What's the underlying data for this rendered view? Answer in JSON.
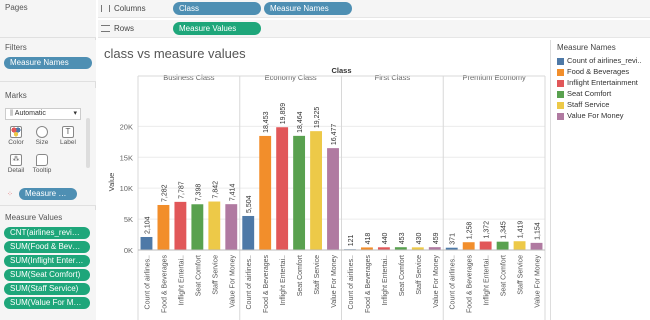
{
  "left": {
    "pages": {
      "title": "Pages"
    },
    "filters": {
      "title": "Filters",
      "pill": "Measure Names"
    },
    "marks": {
      "title": "Marks",
      "type": "Automatic",
      "buttons": [
        "Color",
        "Size",
        "Label",
        "Detail",
        "Tooltip"
      ],
      "pill": "Measure Na.."
    },
    "measure_values": {
      "title": "Measure Values",
      "items": [
        "CNT(airlines_reviews..",
        "SUM(Food & Bevera..",
        "SUM(Inflight Enterta..",
        "SUM(Seat Comfort)",
        "SUM(Staff Service)",
        "SUM(Value For Mone.."
      ]
    }
  },
  "shelves": {
    "columns": {
      "label": "Columns",
      "pills": [
        "Class",
        "Measure Names"
      ]
    },
    "rows": {
      "label": "Rows",
      "pills": [
        "Measure Values"
      ]
    }
  },
  "legend": {
    "title": "Measure Names",
    "items": [
      {
        "label": "Count of airlines_revi..",
        "color": "#4e79a7"
      },
      {
        "label": "Food & Beverages",
        "color": "#f28e2b"
      },
      {
        "label": "Inflight Entertainment",
        "color": "#e15759"
      },
      {
        "label": "Seat Comfort",
        "color": "#59a14f"
      },
      {
        "label": "Staff Service",
        "color": "#edc948"
      },
      {
        "label": "Value For Money",
        "color": "#b07aa1"
      }
    ]
  },
  "chart_data": {
    "type": "bar",
    "title": "class vs measure values",
    "column_header": "Class",
    "ylabel": "Value",
    "ylim": [
      0,
      22000
    ],
    "yticks": [
      0,
      5000,
      10000,
      15000,
      20000
    ],
    "ytick_labels": [
      "0K",
      "5K",
      "10K",
      "15K",
      "20K"
    ],
    "groups": [
      "Business Class",
      "Economy Class",
      "First Class",
      "Premium Economy"
    ],
    "categories": [
      "Count of airlines..",
      "Food & Beverages",
      "Inflight Entertai..",
      "Seat Comfort",
      "Staff Service",
      "Value For Money"
    ],
    "colors": [
      "#4e79a7",
      "#f28e2b",
      "#e15759",
      "#59a14f",
      "#edc948",
      "#b07aa1"
    ],
    "values": [
      [
        2104,
        7282,
        7787,
        7398,
        7842,
        7414
      ],
      [
        5504,
        18453,
        19859,
        18464,
        19225,
        16477
      ],
      [
        121,
        418,
        440,
        453,
        430,
        459
      ],
      [
        371,
        1258,
        1372,
        1345,
        1419,
        1154
      ]
    ],
    "value_labels": [
      [
        "2,104",
        "7,282",
        "7,787",
        "7,398",
        "7,842",
        "7,414"
      ],
      [
        "5,504",
        "18,453",
        "19,859",
        "18,464",
        "19,225",
        "16,477"
      ],
      [
        "121",
        "418",
        "440",
        "453",
        "430",
        "459"
      ],
      [
        "371",
        "1,258",
        "1,372",
        "1,345",
        "1,419",
        "1,154"
      ]
    ]
  }
}
